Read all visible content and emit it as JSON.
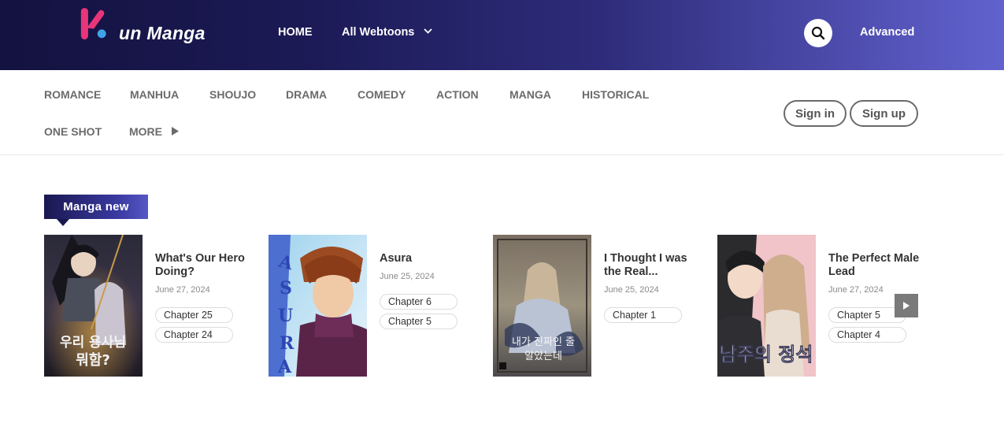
{
  "header": {
    "logo_text": "un Manga",
    "nav_home": "HOME",
    "nav_all": "All Webtoons",
    "advanced": "Advanced",
    "icons": {
      "search": "search-icon",
      "chevron": "chevron-down-icon"
    }
  },
  "genres": {
    "row1": [
      "ROMANCE",
      "MANHUA",
      "SHOUJO",
      "DRAMA",
      "COMEDY",
      "ACTION",
      "MANGA",
      "HISTORICAL"
    ],
    "row2": [
      "ONE SHOT",
      "MORE"
    ]
  },
  "auth": {
    "sign_in": "Sign in",
    "sign_up": "Sign up"
  },
  "section": {
    "title": "Manga new"
  },
  "manga": [
    {
      "title": "What's Our Hero Doing?",
      "date": "June 27, 2024",
      "chapters": [
        "Chapter 25",
        "Chapter 24"
      ]
    },
    {
      "title": "Asura",
      "date": "June 25, 2024",
      "chapters": [
        "Chapter 6",
        "Chapter 5"
      ]
    },
    {
      "title": "I Thought I was the Real...",
      "date": "June 25, 2024",
      "chapters": [
        "Chapter 1"
      ]
    },
    {
      "title": "The Perfect Male Lead",
      "date": "June 27, 2024",
      "chapters": [
        "Chapter 5",
        "Chapter 4"
      ]
    }
  ],
  "colors": {
    "header_dark": "#14123f",
    "header_light": "#6262cf",
    "logo_pink": "#e8357a",
    "logo_blue": "#3fa3e8"
  }
}
